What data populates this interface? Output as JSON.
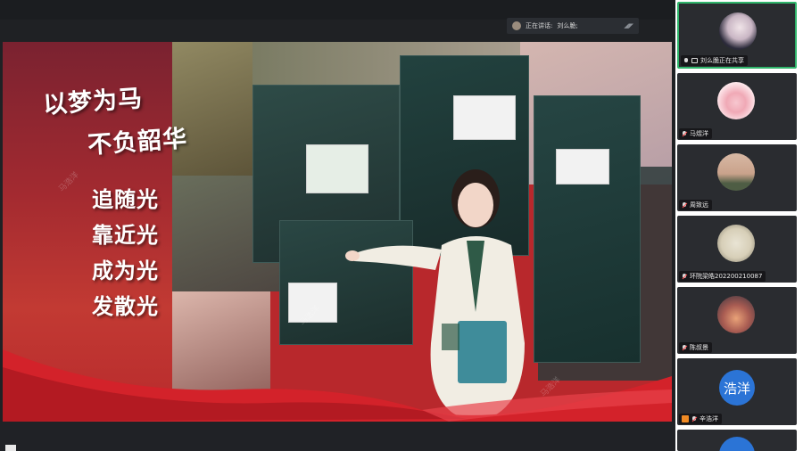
{
  "speaking": {
    "label": "正在讲话:",
    "name": "刘么脆;"
  },
  "slide": {
    "slogans": [
      "以梦为马",
      "不负韶华",
      "追随光",
      "靠近光",
      "成为光",
      "发散光"
    ],
    "watermark": "马浩洋"
  },
  "participants": [
    {
      "name": "刘么脆正在共享",
      "status": "sharing",
      "mic": "on",
      "avatar": "photo-girl-avatar"
    },
    {
      "name": "马煜洋",
      "status": "",
      "mic": "muted",
      "avatar": "cartoon-pig-avatar"
    },
    {
      "name": "周致远",
      "status": "",
      "mic": "muted",
      "avatar": "sunset-sky-avatar"
    },
    {
      "name": "环院梁皓202200210087",
      "status": "",
      "mic": "muted",
      "avatar": "clock-avatar"
    },
    {
      "name": "陈叔景",
      "status": "",
      "mic": "muted",
      "avatar": "dusk-lights-avatar"
    },
    {
      "name": "辛浩洋",
      "status": "",
      "mic": "muted",
      "avatar_text": "浩洋"
    }
  ],
  "colors": {
    "active_border": "#2fb56b",
    "name_avatar_bg": "#2b74d6",
    "ribbon": "#d3222a"
  }
}
